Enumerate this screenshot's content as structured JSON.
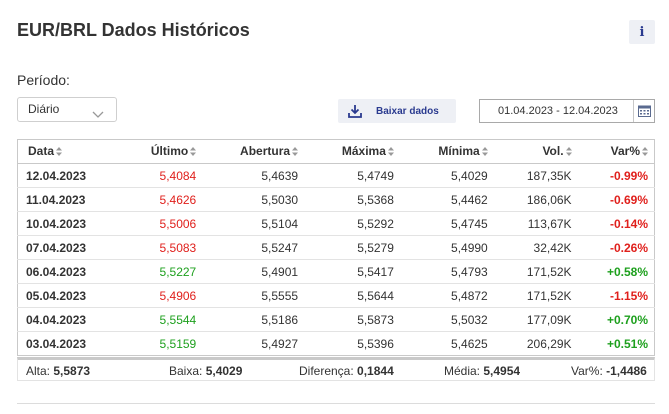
{
  "header": {
    "title": "EUR/BRL Dados Históricos",
    "info_label": "i"
  },
  "period": {
    "label": "Período:",
    "selected": "Diário"
  },
  "download": {
    "label": "Baixar dados"
  },
  "date_range": {
    "value": "01.04.2023 - 12.04.2023"
  },
  "table": {
    "columns": [
      "Data",
      "Último",
      "Abertura",
      "Máxima",
      "Mínima",
      "Vol.",
      "Var%"
    ],
    "rows": [
      {
        "date": "12.04.2023",
        "last": "5,4084",
        "open": "5,4639",
        "high": "5,4749",
        "low": "5,4029",
        "vol": "187,35K",
        "var": "-0.99%"
      },
      {
        "date": "11.04.2023",
        "last": "5,4626",
        "open": "5,5030",
        "high": "5,5368",
        "low": "5,4462",
        "vol": "186,06K",
        "var": "-0.69%"
      },
      {
        "date": "10.04.2023",
        "last": "5,5006",
        "open": "5,5104",
        "high": "5,5292",
        "low": "5,4745",
        "vol": "113,67K",
        "var": "-0.14%"
      },
      {
        "date": "07.04.2023",
        "last": "5,5083",
        "open": "5,5247",
        "high": "5,5279",
        "low": "5,4990",
        "vol": "32,42K",
        "var": "-0.26%"
      },
      {
        "date": "06.04.2023",
        "last": "5,5227",
        "open": "5,4901",
        "high": "5,5417",
        "low": "5,4793",
        "vol": "171,52K",
        "var": "+0.58%"
      },
      {
        "date": "05.04.2023",
        "last": "5,4906",
        "open": "5,5555",
        "high": "5,5644",
        "low": "5,4872",
        "vol": "171,52K",
        "var": "-1.15%"
      },
      {
        "date": "04.04.2023",
        "last": "5,5544",
        "open": "5,5186",
        "high": "5,5873",
        "low": "5,5032",
        "vol": "177,09K",
        "var": "+0.70%"
      },
      {
        "date": "03.04.2023",
        "last": "5,5159",
        "open": "5,4927",
        "high": "5,5396",
        "low": "5,4625",
        "vol": "206,29K",
        "var": "+0.51%"
      }
    ]
  },
  "summary": {
    "high_label": "Alta:",
    "high_value": "5,5873",
    "low_label": "Baixa:",
    "low_value": "5,4029",
    "diff_label": "Diferença:",
    "diff_value": "0,1844",
    "avg_label": "Média:",
    "avg_value": "5,4954",
    "var_label": "Var%:",
    "var_value": "-1,4486"
  },
  "colors": {
    "negative": "#e0201c",
    "positive": "#1ea01e",
    "accent": "#2a3a8f"
  },
  "icons": {
    "info": "info-icon",
    "dropdown": "chevron-down-icon",
    "download": "download-icon",
    "calendar": "calendar-icon",
    "sort": "sort-icon"
  }
}
